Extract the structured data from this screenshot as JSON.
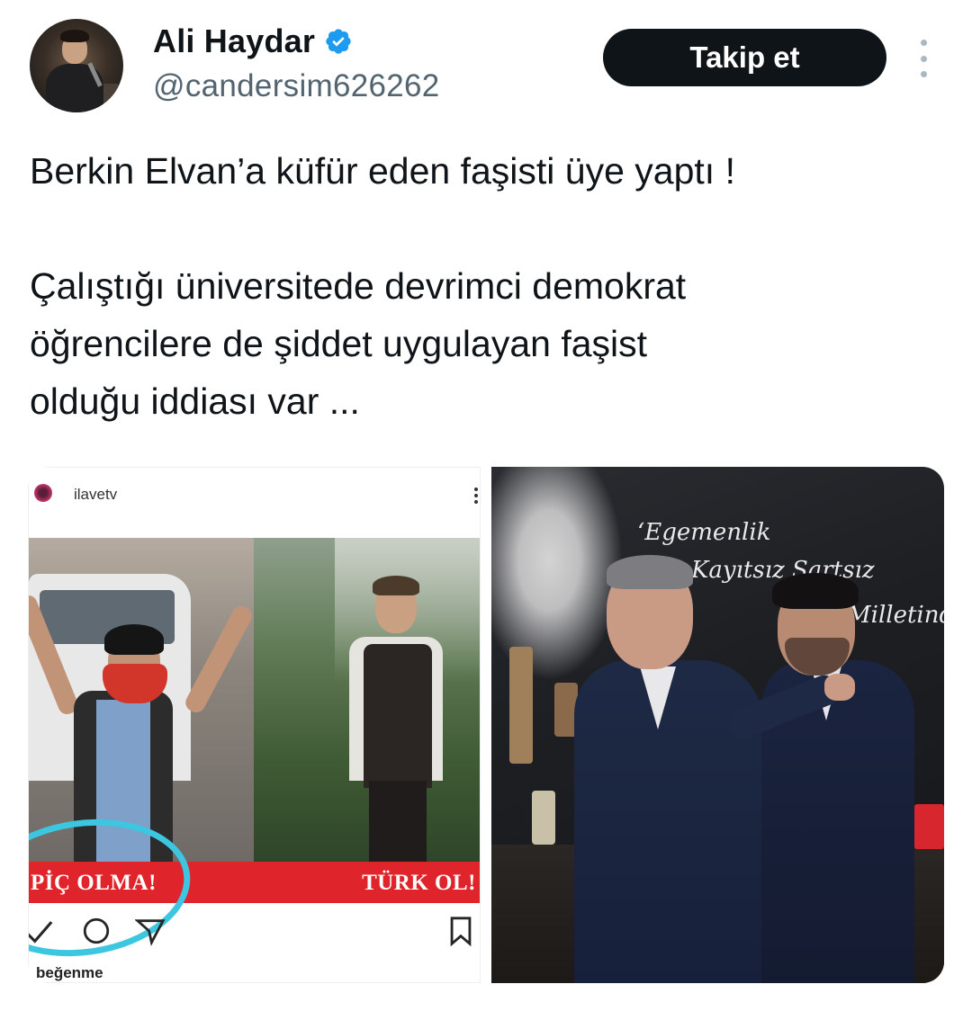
{
  "author": {
    "display_name": "Ali Haydar",
    "handle": "@candersim626262",
    "verified_color": "#1d9bf0"
  },
  "actions": {
    "follow_label": "Takip et"
  },
  "tweet": {
    "paragraph_1": "Berkin Elvan’a küfür eden faşisti üye yaptı !",
    "paragraph_2_line_1": "Çalıştığı üniversitede devrimci demokrat",
    "paragraph_2_line_2": "öğrencilere de şiddet uygulayan faşist",
    "paragraph_2_line_3": "olduğu iddiası var ..."
  },
  "media": {
    "left_image": {
      "ig_account": "ilavetv",
      "banner_left": "PİÇ OLMA!",
      "banner_right": "TÜRK OL!",
      "likes_text": "beğenme",
      "highlight_color": "#3cc6e0",
      "banner_color": "#e0242b"
    },
    "right_image": {
      "wall_text_1": "‘Egemenlik",
      "wall_text_2": "Kayıtsız Şartsız",
      "wall_text_3": "Milletindir"
    }
  },
  "icons": [
    "verified-badge-icon",
    "more-options-icon",
    "ig-like-icon",
    "ig-comment-icon",
    "ig-share-icon",
    "ig-save-icon"
  ]
}
